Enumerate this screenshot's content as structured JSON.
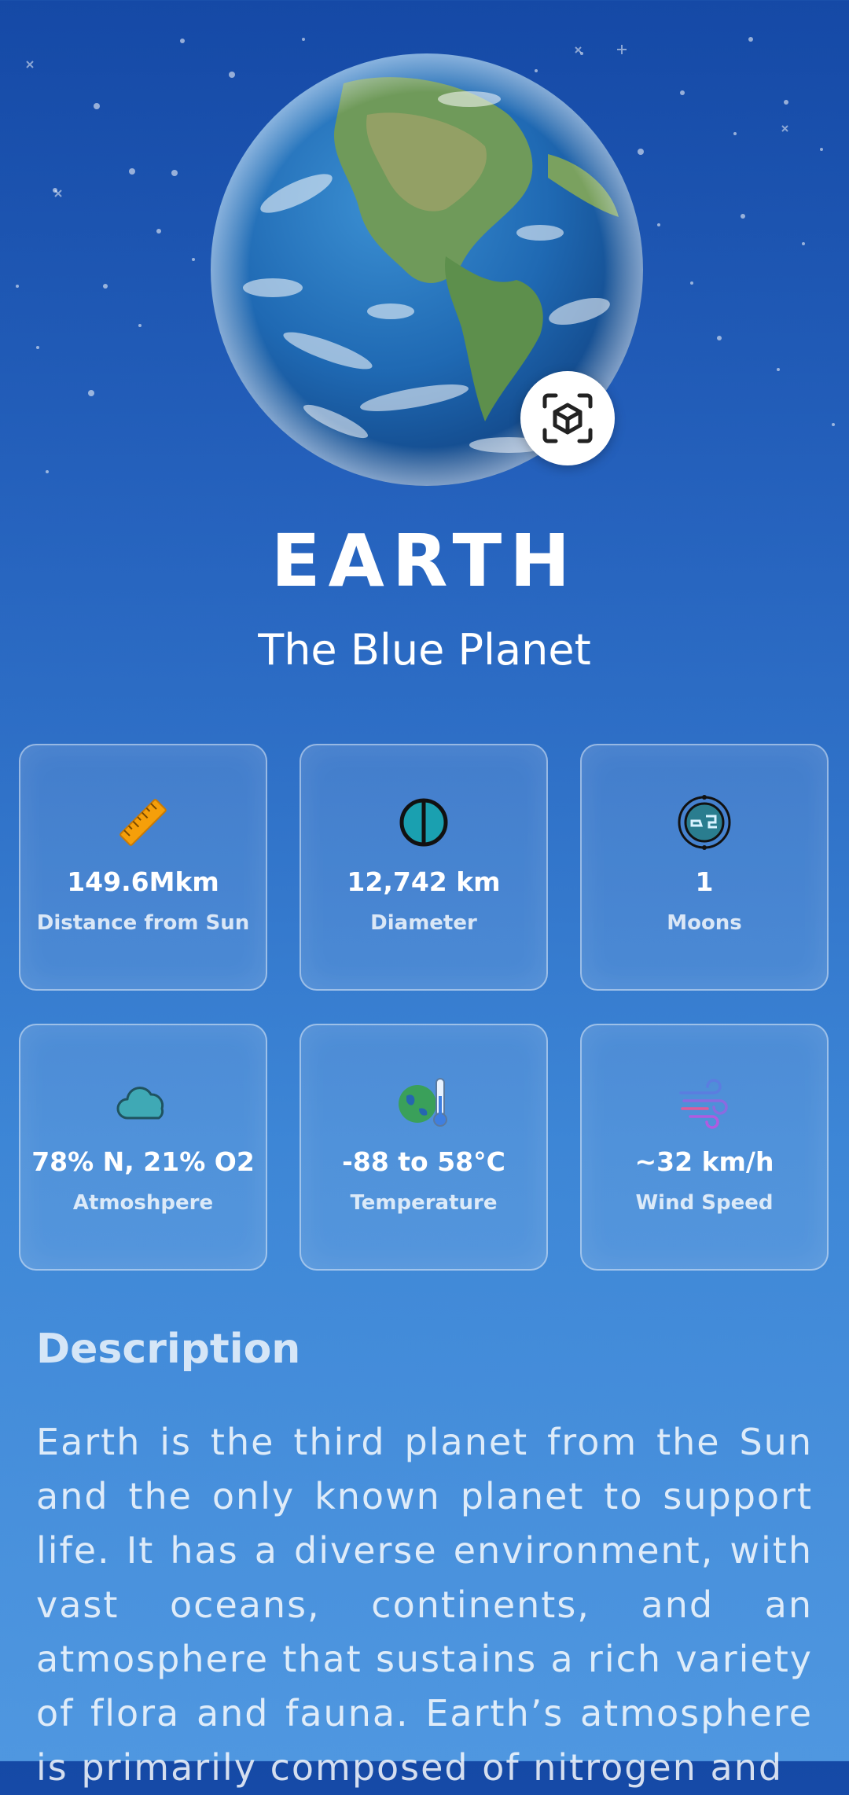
{
  "planet": {
    "title": "EARTH",
    "subtitle": "The Blue Planet",
    "image_icon": "earth-globe",
    "ar_icon": "ar-cube-icon"
  },
  "stats": [
    {
      "icon": "ruler-icon",
      "value": "149.6Mkm",
      "label": "Distance from Sun"
    },
    {
      "icon": "diameter-icon",
      "value": "12,742 km",
      "label": "Diameter"
    },
    {
      "icon": "moon-icon",
      "value": "1",
      "label": "Moons"
    },
    {
      "icon": "cloud-icon",
      "value": "78% N, 21% O2",
      "label": "Atmoshpere"
    },
    {
      "icon": "thermometer-earth-icon",
      "value": "-88 to 58°C",
      "label": "Temperature"
    },
    {
      "icon": "wind-icon",
      "value": "~32 km/h",
      "label": "Wind Speed"
    }
  ],
  "description": {
    "heading": "Description",
    "text": "Earth is the third planet from the Sun and the only known planet to support life. It has a diverse environment, with vast oceans, continents, and an atmosphere that sustains a rich variety of flora and fauna. Earth’s atmosphere is primarily composed of nitrogen and"
  },
  "colors": {
    "background_top": "#1549a6",
    "background_bottom": "#4f97e0",
    "ruler": "#f59f0a",
    "cloud": "#3fa9b5"
  }
}
